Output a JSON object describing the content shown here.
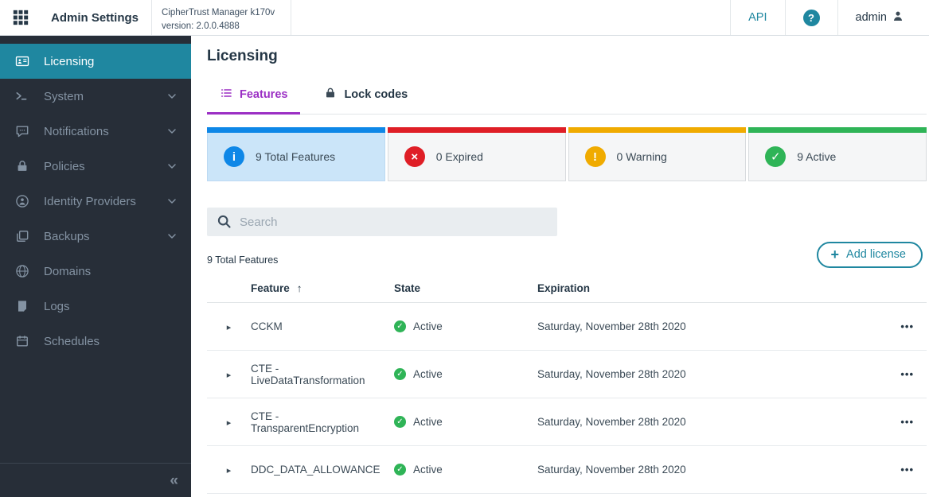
{
  "theme": {
    "accent_teal": "#1f87a0",
    "tab_purple": "#9b2fc4",
    "sidebar_bg": "#272e38",
    "navy": "#253746",
    "selected_card_bg": "#cbe5f9"
  },
  "header": {
    "app_title": "Admin Settings",
    "product_line1": "CipherTrust Manager k170v",
    "product_line2": "version: 2.0.0.4888",
    "api_label": "API",
    "help_label": "?",
    "user_label": "admin"
  },
  "sidebar": {
    "items": [
      {
        "label": "Licensing",
        "icon": "id-card",
        "active": true,
        "chevron": false
      },
      {
        "label": "System",
        "icon": "terminal",
        "active": false,
        "chevron": true
      },
      {
        "label": "Notifications",
        "icon": "comment",
        "active": false,
        "chevron": true
      },
      {
        "label": "Policies",
        "icon": "lock",
        "active": false,
        "chevron": true
      },
      {
        "label": "Identity Providers",
        "icon": "user-circle",
        "active": false,
        "chevron": true
      },
      {
        "label": "Backups",
        "icon": "copy",
        "active": false,
        "chevron": true
      },
      {
        "label": "Domains",
        "icon": "globe",
        "active": false,
        "chevron": false
      },
      {
        "label": "Logs",
        "icon": "file",
        "active": false,
        "chevron": false
      },
      {
        "label": "Schedules",
        "icon": "calendar",
        "active": false,
        "chevron": false
      }
    ],
    "collapse_glyph": "«"
  },
  "main": {
    "page_title": "Licensing",
    "tabs": [
      {
        "label": "Features",
        "active": true
      },
      {
        "label": "Lock codes",
        "active": false
      }
    ],
    "summary_cards": [
      {
        "label": "9 Total Features",
        "type": "info",
        "color": "#0e87e7",
        "selected": true
      },
      {
        "label": "0 Expired",
        "type": "error",
        "color": "#df1e26",
        "selected": false
      },
      {
        "label": "0 Warning",
        "type": "warning",
        "color": "#f0ab00",
        "selected": false
      },
      {
        "label": "9 Active",
        "type": "success",
        "color": "#2fb457",
        "selected": false
      }
    ],
    "search_placeholder": "Search",
    "count_label": "9 Total Features",
    "add_license_label": "Add license",
    "table": {
      "columns": {
        "feature": "Feature",
        "state": "State",
        "expiration": "Expiration"
      },
      "sort_column": "Feature",
      "sort_direction": "asc",
      "rows": [
        {
          "feature": "CCKM",
          "state": "Active",
          "expiration": "Saturday, November 28th 2020"
        },
        {
          "feature": "CTE - LiveDataTransformation",
          "state": "Active",
          "expiration": "Saturday, November 28th 2020"
        },
        {
          "feature": "CTE - TransparentEncryption",
          "state": "Active",
          "expiration": "Saturday, November 28th 2020"
        },
        {
          "feature": "DDC_DATA_ALLOWANCE",
          "state": "Active",
          "expiration": "Saturday, November 28th 2020"
        }
      ]
    }
  }
}
